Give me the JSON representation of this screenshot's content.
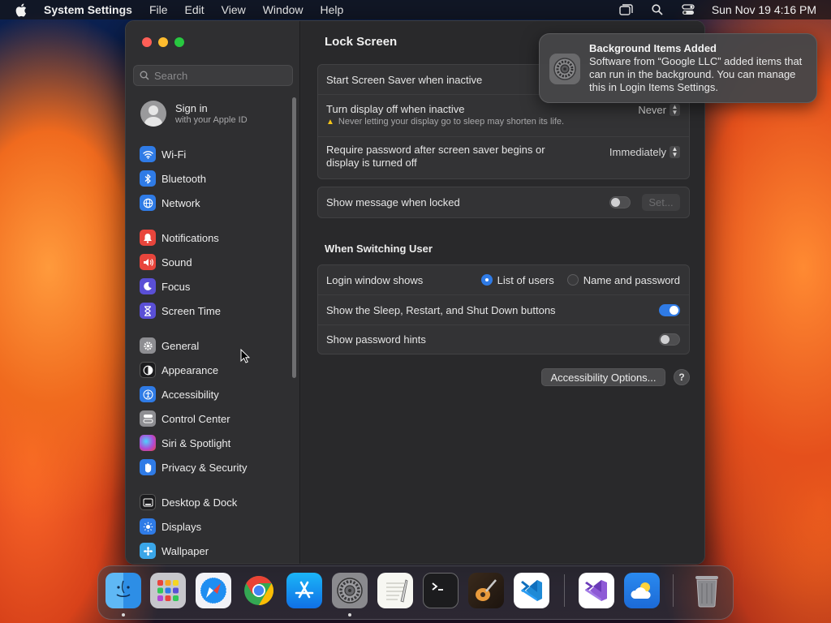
{
  "menubar": {
    "app_name": "System Settings",
    "menus": [
      "File",
      "Edit",
      "View",
      "Window",
      "Help"
    ],
    "clock": "Sun Nov 19  4:16 PM"
  },
  "sidebar": {
    "search_placeholder": "Search",
    "signin": {
      "title": "Sign in",
      "subtitle": "with your Apple ID"
    },
    "groups": [
      [
        {
          "label": "Wi-Fi",
          "icon": "wifi-icon",
          "color": "#2f7be6"
        },
        {
          "label": "Bluetooth",
          "icon": "bluetooth-icon",
          "color": "#2f7be6"
        },
        {
          "label": "Network",
          "icon": "globe-icon",
          "color": "#2f7be6"
        }
      ],
      [
        {
          "label": "Notifications",
          "icon": "bell-icon",
          "color": "#e8453c"
        },
        {
          "label": "Sound",
          "icon": "speaker-icon",
          "color": "#e8453c"
        },
        {
          "label": "Focus",
          "icon": "moon-icon",
          "color": "#5a4fd6"
        },
        {
          "label": "Screen Time",
          "icon": "hourglass-icon",
          "color": "#5a4fd6"
        }
      ],
      [
        {
          "label": "General",
          "icon": "gear-icon",
          "color": "#8e8e92"
        },
        {
          "label": "Appearance",
          "icon": "appearance-icon",
          "color": "#1c1c1e"
        },
        {
          "label": "Accessibility",
          "icon": "accessibility-icon",
          "color": "#2f7be6"
        },
        {
          "label": "Control Center",
          "icon": "control-center-icon",
          "color": "#8e8e92"
        },
        {
          "label": "Siri & Spotlight",
          "icon": "siri-icon",
          "color": "#b04ad6"
        },
        {
          "label": "Privacy & Security",
          "icon": "hand-icon",
          "color": "#2f7be6"
        }
      ],
      [
        {
          "label": "Desktop & Dock",
          "icon": "dock-icon",
          "color": "#1c1c1e"
        },
        {
          "label": "Displays",
          "icon": "sun-icon",
          "color": "#2f7be6"
        },
        {
          "label": "Wallpaper",
          "icon": "wallpaper-icon",
          "color": "#3aa6e8"
        }
      ]
    ]
  },
  "content": {
    "title": "Lock Screen",
    "screensaver_label": "Start Screen Saver when inactive",
    "display_off_label": "Turn display off when inactive",
    "display_off_value": "Never",
    "display_off_warning": "Never letting your display go to sleep may shorten its life.",
    "require_password_label": "Require password after screen saver begins or display is turned off",
    "require_password_value": "Immediately",
    "show_message_label": "Show message when locked",
    "show_message_on": false,
    "set_button": "Set...",
    "switching_title": "When Switching User",
    "login_window_label": "Login window shows",
    "login_options": [
      "List of users",
      "Name and password"
    ],
    "login_selected": "List of users",
    "sleep_buttons_label": "Show the Sleep, Restart, and Shut Down buttons",
    "sleep_buttons_on": true,
    "password_hints_label": "Show password hints",
    "password_hints_on": false,
    "accessibility_button": "Accessibility Options...",
    "help_button": "?"
  },
  "notification": {
    "title": "Background Items Added",
    "body": "Software from “Google LLC” added items that can run in the background. You can manage this in Login Items Settings."
  },
  "dock": {
    "apps": [
      "finder-icon",
      "launchpad-icon",
      "safari-icon",
      "chrome-icon",
      "app-store-icon",
      "system-settings-icon",
      "textedit-icon",
      "terminal-icon",
      "garageband-icon",
      "vscode-icon",
      "visual-studio-icon",
      "weather-icon",
      "trash-icon"
    ]
  }
}
